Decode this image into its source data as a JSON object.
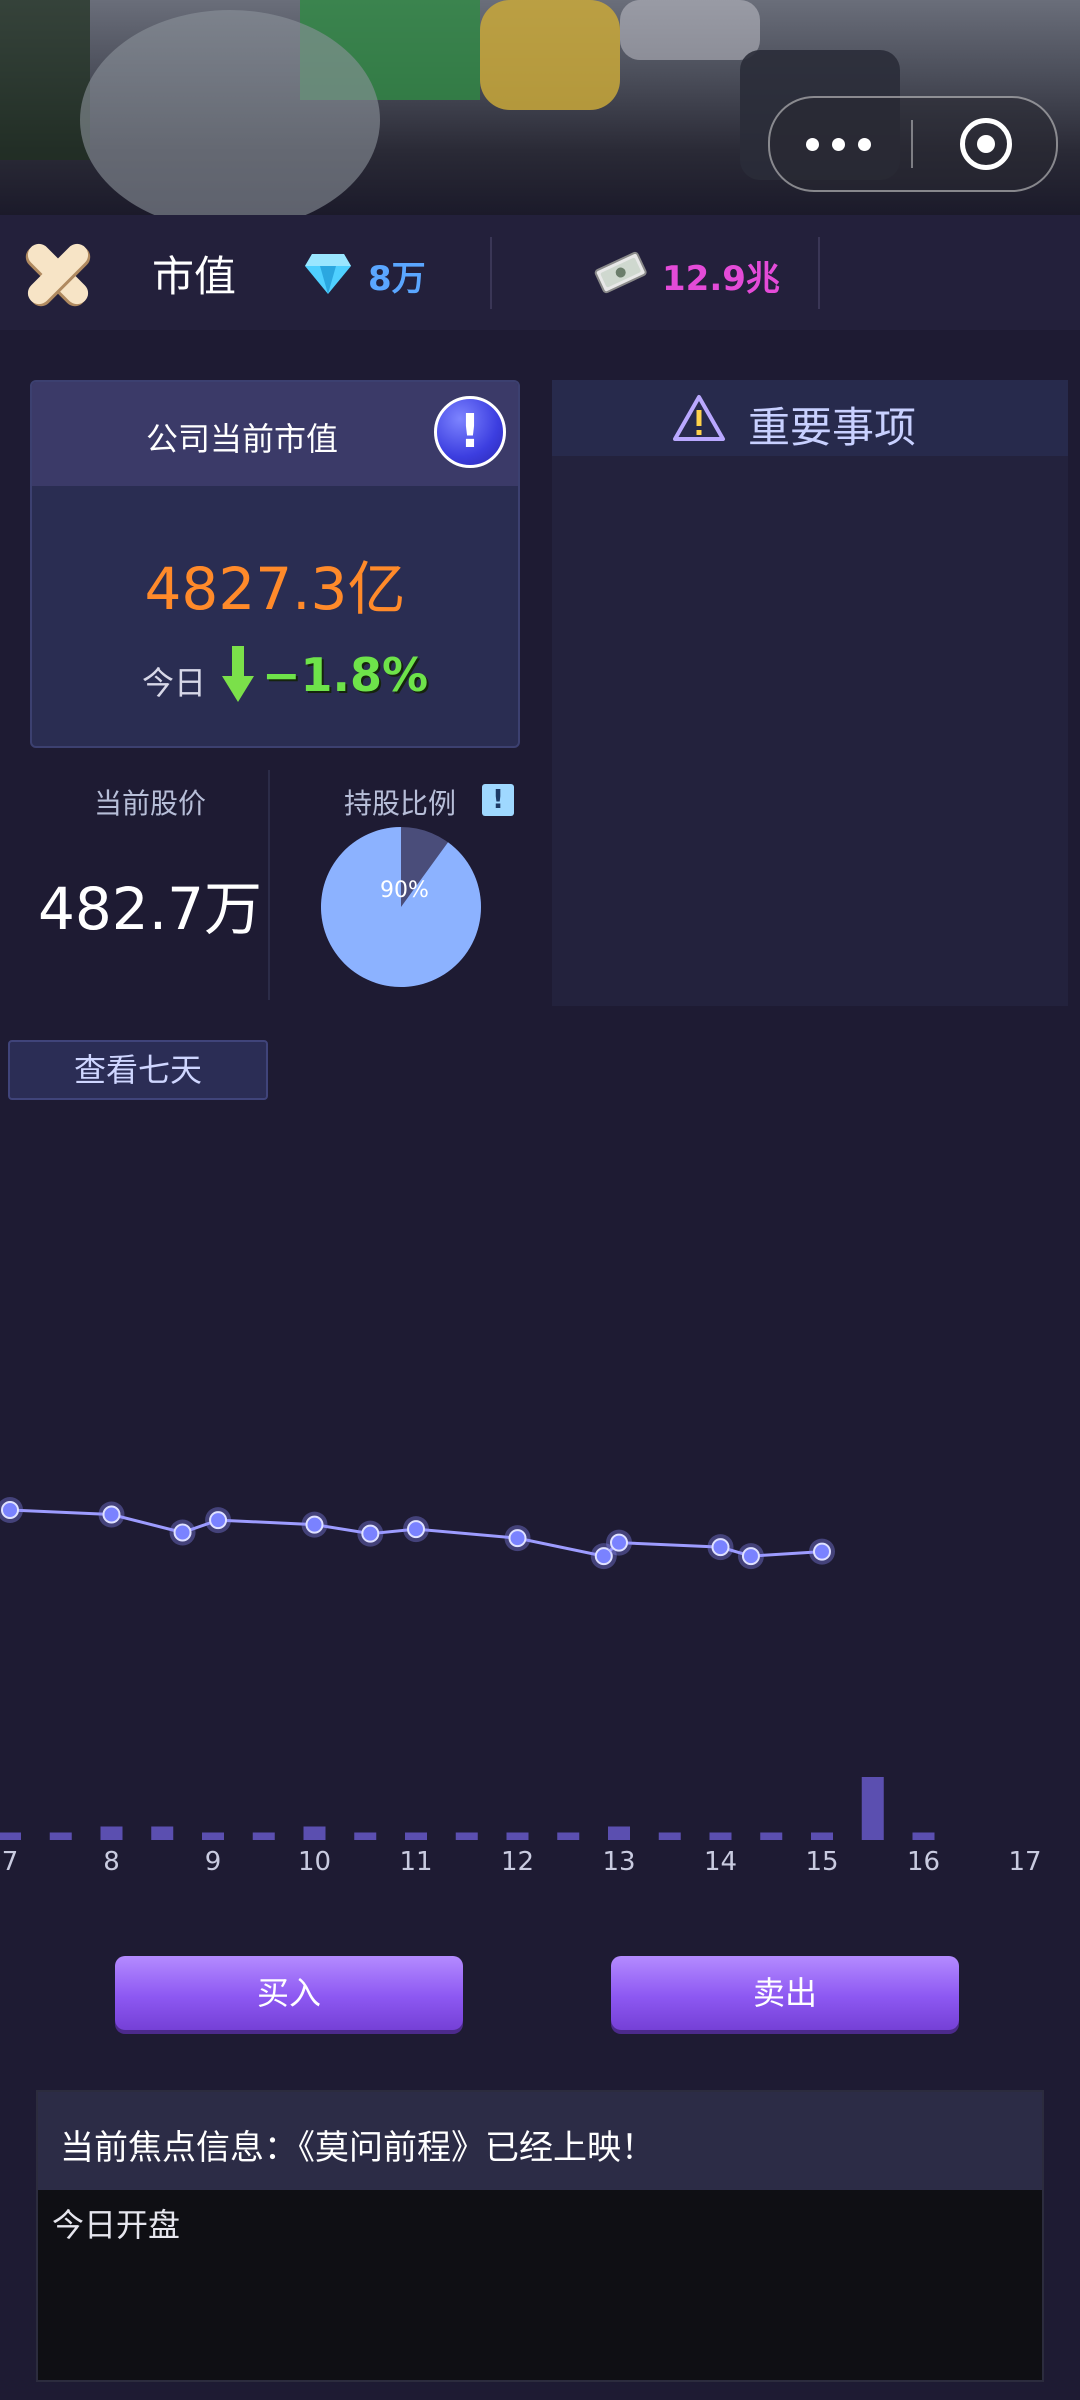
{
  "header": {
    "title": "市值",
    "diamonds": "8万",
    "cash": "12.9兆"
  },
  "market_cap": {
    "title": "公司当前市值",
    "value": "4827.3亿",
    "today_label": "今日",
    "change": "−1.8%",
    "info_label": "!"
  },
  "important": {
    "title": "重要事项"
  },
  "stock": {
    "price_label": "当前股价",
    "price_value": "482.7万",
    "holding_label": "持股比例",
    "holding_info": "!",
    "holding_percent_label": "90%",
    "holding_fraction": 0.9
  },
  "view_seven_days": "查看七天",
  "actions": {
    "buy": "买入",
    "sell": "卖出"
  },
  "news": {
    "title": "当前焦点信息：《莫问前程》已经上映！",
    "body": "今日开盘"
  },
  "colors": {
    "line": "#8e8cff",
    "point": "#7a82ff",
    "bar": "#5b4fb0",
    "pie": "#8cb2ff",
    "pie_rest": "#4a4d7a"
  },
  "chart_data": {
    "type": "line",
    "x_ticks": [
      "7",
      "8",
      "9",
      "10",
      "11",
      "12",
      "13",
      "14",
      "15",
      "16",
      "17"
    ],
    "line_points": [
      {
        "x": 7.0,
        "y": 0.88
      },
      {
        "x": 8.0,
        "y": 0.868
      },
      {
        "x": 8.7,
        "y": 0.82
      },
      {
        "x": 9.05,
        "y": 0.853
      },
      {
        "x": 10.0,
        "y": 0.841
      },
      {
        "x": 10.55,
        "y": 0.817
      },
      {
        "x": 11.0,
        "y": 0.829
      },
      {
        "x": 12.0,
        "y": 0.805
      },
      {
        "x": 12.85,
        "y": 0.757
      },
      {
        "x": 13.0,
        "y": 0.793
      },
      {
        "x": 14.0,
        "y": 0.781
      },
      {
        "x": 14.3,
        "y": 0.757
      },
      {
        "x": 15.0,
        "y": 0.769
      }
    ],
    "bars": [
      {
        "x": 7.0,
        "v": 0.05
      },
      {
        "x": 7.5,
        "v": 0.05
      },
      {
        "x": 8.0,
        "v": 0.09
      },
      {
        "x": 8.5,
        "v": 0.09
      },
      {
        "x": 9.0,
        "v": 0.05
      },
      {
        "x": 9.5,
        "v": 0.05
      },
      {
        "x": 10.0,
        "v": 0.09
      },
      {
        "x": 10.5,
        "v": 0.05
      },
      {
        "x": 11.0,
        "v": 0.05
      },
      {
        "x": 11.5,
        "v": 0.05
      },
      {
        "x": 12.0,
        "v": 0.05
      },
      {
        "x": 12.5,
        "v": 0.05
      },
      {
        "x": 13.0,
        "v": 0.09
      },
      {
        "x": 13.5,
        "v": 0.05
      },
      {
        "x": 14.0,
        "v": 0.05
      },
      {
        "x": 14.5,
        "v": 0.05
      },
      {
        "x": 15.0,
        "v": 0.05
      },
      {
        "x": 15.5,
        "v": 0.42
      },
      {
        "x": 16.0,
        "v": 0.05
      }
    ],
    "xlim": [
      7,
      17
    ]
  }
}
